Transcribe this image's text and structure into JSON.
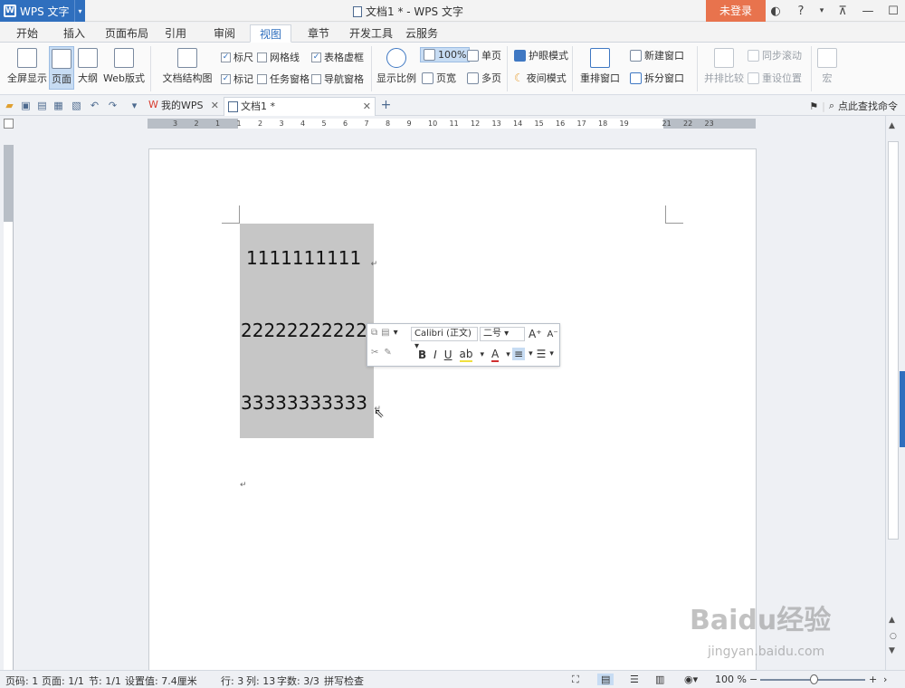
{
  "app": {
    "name": "WPS 文字",
    "doc_title": "文档1 * - WPS 文字",
    "login": "未登录",
    "help": "?"
  },
  "menu_tabs": [
    "开始",
    "插入",
    "页面布局",
    "引用",
    "审阅",
    "视图",
    "章节",
    "开发工具",
    "云服务"
  ],
  "active_tab": "视图",
  "ribbon": {
    "fullscreen": "全屏显示",
    "page": "页面",
    "outline": "大纲",
    "web": "Web版式",
    "doc_structure": "文档结构图",
    "ruler": "标尺",
    "gridlines": "网格线",
    "table_dotted": "表格虚框",
    "marks": "标记",
    "task_pane": "任务窗格",
    "nav_pane": "导航窗格",
    "zoom": "显示比例",
    "zoom_100": "100%",
    "page_width": "页宽",
    "single_page": "单页",
    "multi_page": "多页",
    "eye_mode": "护眼模式",
    "night_mode": "夜间模式",
    "rearrange": "重排窗口",
    "new_window": "新建窗口",
    "split_window": "拆分窗口",
    "side_by_side": "并排比较",
    "sync_scroll": "同步滚动",
    "reset_pos": "重设位置",
    "macro": "宏"
  },
  "doc_tabs": {
    "my_wps": "我的WPS",
    "doc1": "文档1 *",
    "find_cmd": "点此查找命令"
  },
  "ruler_numbers": [
    "3",
    "2",
    "1",
    "1",
    "2",
    "3",
    "4",
    "5",
    "6",
    "7",
    "8",
    "9",
    "10",
    "11",
    "12",
    "13",
    "14",
    "15",
    "16",
    "17",
    "18",
    "19",
    "21",
    "22",
    "23"
  ],
  "document": {
    "line1": "1111111111",
    "line2": "22222222222",
    "line3": "33333333333",
    "para_mark": "↵"
  },
  "mini_toolbar": {
    "font": "Calibri (正文)",
    "size": "二号",
    "bold": "B",
    "italic": "I",
    "underline": "U",
    "font_color": "A"
  },
  "status": {
    "page_code": "页码: 1",
    "pages": "页面: 1/1",
    "section": "节: 1/1",
    "setting": "设置值: 7.4厘米",
    "row": "行: 3",
    "col": "列: 13",
    "words": "字数: 3/3",
    "spell": "拼写检查",
    "zoom": "100 %"
  },
  "watermark": {
    "brand": "Baidu经验",
    "url": "jingyan.baidu.com"
  },
  "colors": {
    "accent": "#2f6fbe",
    "login": "#e8734d",
    "selection": "#c6c6c6"
  }
}
